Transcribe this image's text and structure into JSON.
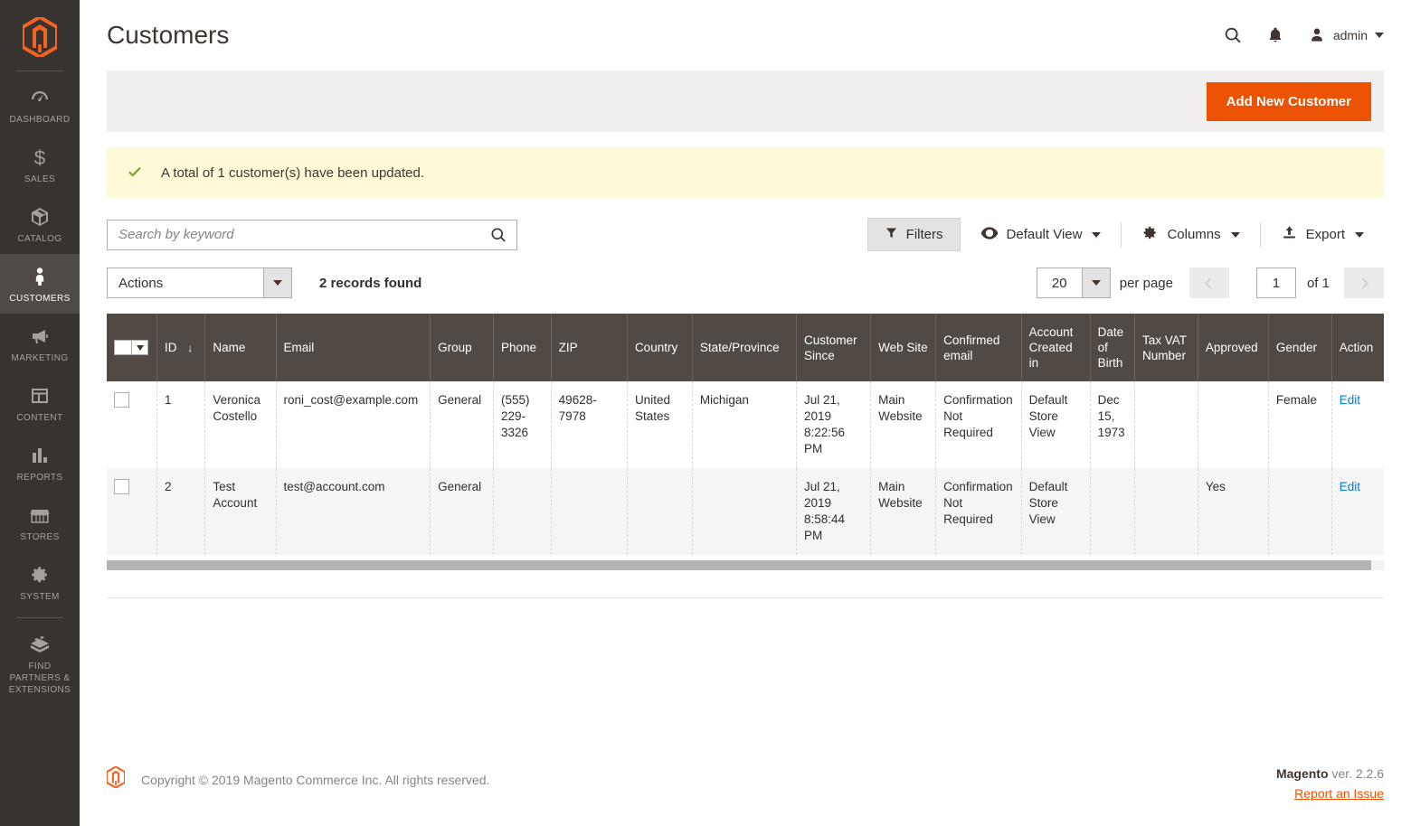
{
  "sidebar": {
    "logo_name": "magento-logo",
    "items": [
      {
        "label": "DASHBOARD",
        "icon": "dashboard-icon",
        "active": false
      },
      {
        "label": "SALES",
        "icon": "dollar-icon",
        "active": false
      },
      {
        "label": "CATALOG",
        "icon": "box-icon",
        "active": false
      },
      {
        "label": "CUSTOMERS",
        "icon": "person-icon",
        "active": true
      },
      {
        "label": "MARKETING",
        "icon": "megaphone-icon",
        "active": false
      },
      {
        "label": "CONTENT",
        "icon": "layout-icon",
        "active": false
      },
      {
        "label": "REPORTS",
        "icon": "bar-chart-icon",
        "active": false
      },
      {
        "label": "STORES",
        "icon": "storefront-icon",
        "active": false
      },
      {
        "label": "SYSTEM",
        "icon": "gear-icon",
        "active": false
      },
      {
        "label": "FIND PARTNERS & EXTENSIONS",
        "icon": "lego-brick-icon",
        "active": false
      }
    ]
  },
  "header": {
    "title": "Customers",
    "search_icon": "search-icon",
    "notifications_icon": "bell-icon",
    "admin_label": "admin"
  },
  "actions_bar": {
    "add_new_customer": "Add New Customer"
  },
  "message": {
    "text": "A total of 1 customer(s) have been updated.",
    "type": "success",
    "icon": "check-icon"
  },
  "toolbar": {
    "search_placeholder": "Search by keyword",
    "search_value": "",
    "filters_label": "Filters",
    "default_view_label": "Default View",
    "columns_label": "Columns",
    "export_label": "Export"
  },
  "grid_actions": {
    "actions_label": "Actions",
    "records_found": "2 records found",
    "per_page_value": "20",
    "per_page_label": "per page",
    "page_value": "1",
    "of_label": "of 1"
  },
  "table": {
    "columns": [
      "ID",
      "Name",
      "Email",
      "Group",
      "Phone",
      "ZIP",
      "Country",
      "State/Province",
      "Customer Since",
      "Web Site",
      "Confirmed email",
      "Account Created in",
      "Date of Birth",
      "Tax VAT Number",
      "Approved",
      "Gender",
      "Action"
    ],
    "sort_column": "ID",
    "sort_indicator": "↓",
    "rows": [
      {
        "id": "1",
        "name": "Veronica Costello",
        "email": "roni_cost@example.com",
        "group": "General",
        "phone": "(555) 229-3326",
        "zip": "49628-7978",
        "country": "United States",
        "state": "Michigan",
        "customer_since": "Jul 21, 2019 8:22:56 PM",
        "web_site": "Main Website",
        "confirmed_email": "Confirmation Not Required",
        "account_created_in": "Default Store View",
        "date_of_birth": "Dec 15, 1973",
        "tax_vat": "",
        "approved": "",
        "gender": "Female",
        "action": "Edit"
      },
      {
        "id": "2",
        "name": "Test Account",
        "email": "test@account.com",
        "group": "General",
        "phone": "",
        "zip": "",
        "country": "",
        "state": "",
        "customer_since": "Jul 21, 2019 8:58:44 PM",
        "web_site": "Main Website",
        "confirmed_email": "Confirmation Not Required",
        "account_created_in": "Default Store View",
        "date_of_birth": "",
        "tax_vat": "",
        "approved": "Yes",
        "gender": "",
        "action": "Edit"
      }
    ]
  },
  "footer": {
    "copyright": "Copyright © 2019 Magento Commerce Inc. All rights reserved.",
    "brand": "Magento",
    "version": " ver. 2.2.6",
    "report_issue": "Report an Issue"
  },
  "colors": {
    "accent_orange": "#eb5202",
    "sidebar_bg": "#373330",
    "table_header_bg": "#514943",
    "link_blue": "#007bdb",
    "success_bg": "#fdf9d7"
  }
}
